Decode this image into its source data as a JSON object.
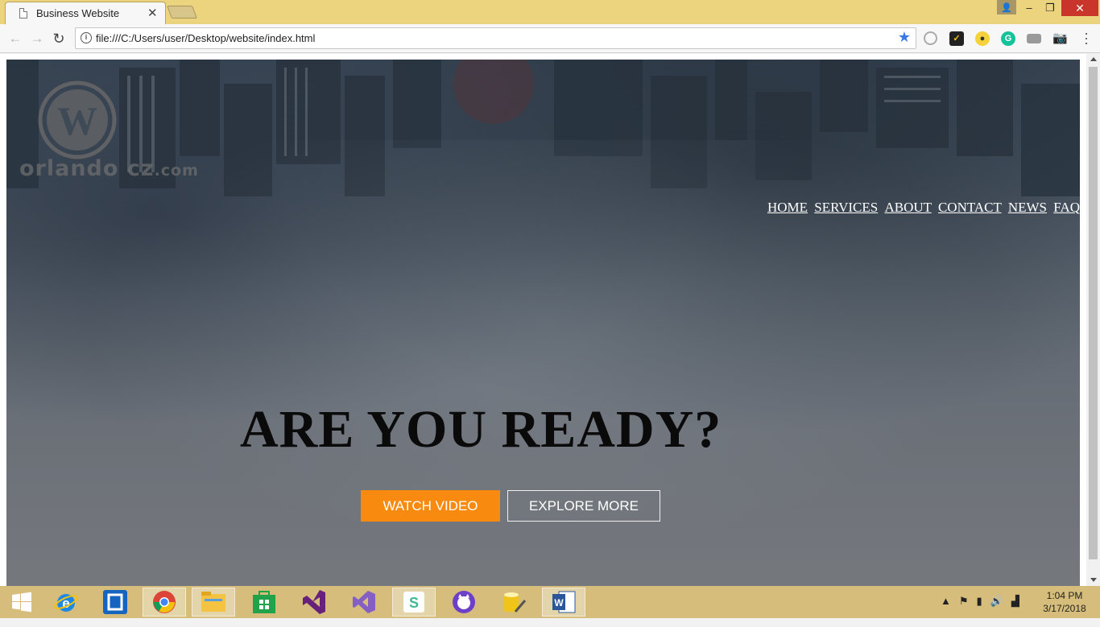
{
  "browser": {
    "tab_title": "Business Website",
    "tab_close": "✕",
    "url": "file:///C:/Users/user/Desktop/website/index.html",
    "window_controls": {
      "minimize": "–",
      "maximize": "❐",
      "close": "✕"
    }
  },
  "page": {
    "logo": {
      "text_main": "orlando cz",
      "text_suffix": ".com"
    },
    "nav": [
      "HOME",
      "SERVICES",
      "ABOUT",
      "CONTACT",
      "NEWS",
      "FAQ"
    ],
    "headline": "ARE YOU READY?",
    "buttons": {
      "watch": "WATCH VIDEO",
      "explore": "EXPLORE MORE"
    },
    "colors": {
      "accent": "#f88a10",
      "hero_bg": "#5f6872",
      "headline": "#0a0a0a"
    }
  },
  "taskbar": {
    "apps": [
      "windows-start",
      "internet-explorer",
      "remote-app",
      "chrome",
      "file-explorer",
      "store",
      "visual-studio",
      "visual-studio-purple",
      "slack",
      "github-desktop",
      "database-tool",
      "word"
    ],
    "time": "1:04 PM",
    "date": "3/17/2018"
  }
}
